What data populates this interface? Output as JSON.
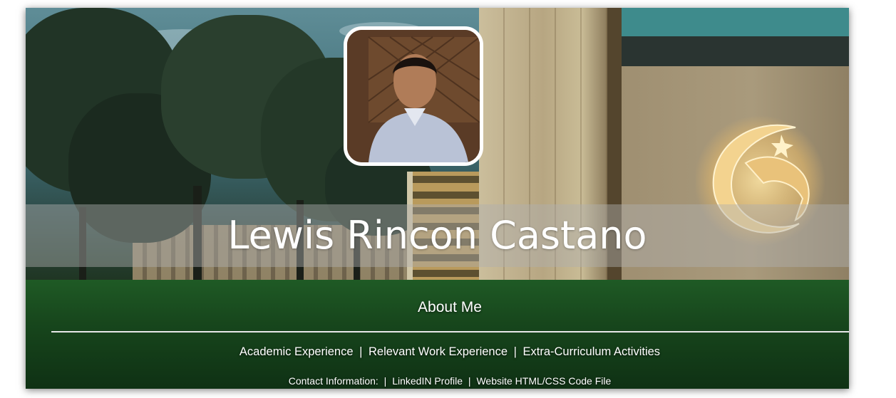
{
  "header": {
    "name": "Lewis Rincon Castano",
    "section_title": "About Me"
  },
  "nav": {
    "items": [
      {
        "label": "Academic Experience"
      },
      {
        "label": "Relevant Work Experience"
      },
      {
        "label": "Extra-Curriculum Activities"
      }
    ],
    "separator": "|"
  },
  "contact": {
    "label": "Contact Information:",
    "links": [
      {
        "label": "LinkedIN Profile"
      },
      {
        "label": "Website HTML/CSS Code File"
      }
    ],
    "separator": "|"
  },
  "colors": {
    "text": "#ffffff",
    "logo_gold": "#e8c47a",
    "lawn": "#1f5a25",
    "band": "rgba(175,175,175,0.45)"
  },
  "images": {
    "background": "campus-building-photo",
    "portrait": "profile-photo",
    "logo": "ucf-pegasus-logo"
  }
}
